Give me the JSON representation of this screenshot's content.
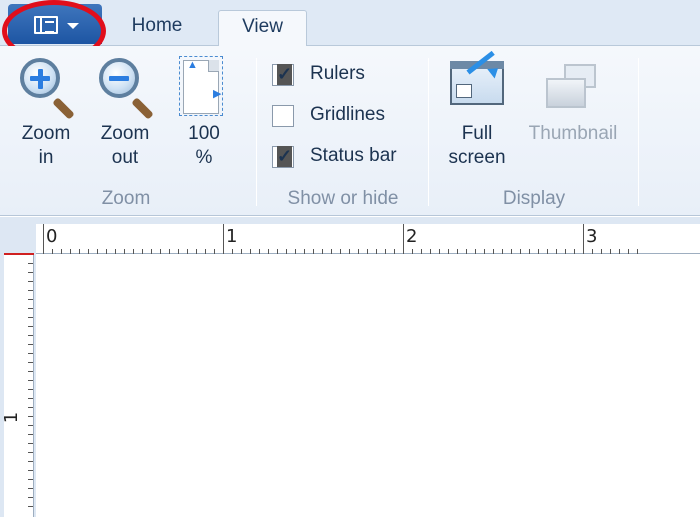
{
  "tabs": {
    "app_menu_icon": "document-icon",
    "home": "Home",
    "view": "View"
  },
  "zoom_group": {
    "zoom_in": {
      "line1": "Zoom",
      "line2": "in",
      "icon": "zoom-in-icon"
    },
    "zoom_out": {
      "line1": "Zoom",
      "line2": "out",
      "icon": "zoom-out-icon"
    },
    "hundred": {
      "line1": "100",
      "line2": "%",
      "icon": "actual-size-icon"
    },
    "label": "Zoom"
  },
  "show_hide_group": {
    "items": [
      {
        "label": "Rulers",
        "checked": true
      },
      {
        "label": "Gridlines",
        "checked": false
      },
      {
        "label": "Status bar",
        "checked": true
      }
    ],
    "label": "Show or hide"
  },
  "display_group": {
    "full_screen": {
      "line1": "Full",
      "line2": "screen",
      "icon": "full-screen-icon"
    },
    "thumbnail": {
      "label": "Thumbnail",
      "icon": "thumbnail-icon",
      "enabled": false
    },
    "label": "Display"
  },
  "ruler": {
    "horizontal_numbers": [
      "0",
      "1",
      "2",
      "3"
    ],
    "vertical_numbers": [
      "1"
    ]
  },
  "colors": {
    "highlight_circle": "#e10e1b",
    "app_menu": "#1d55a3"
  }
}
